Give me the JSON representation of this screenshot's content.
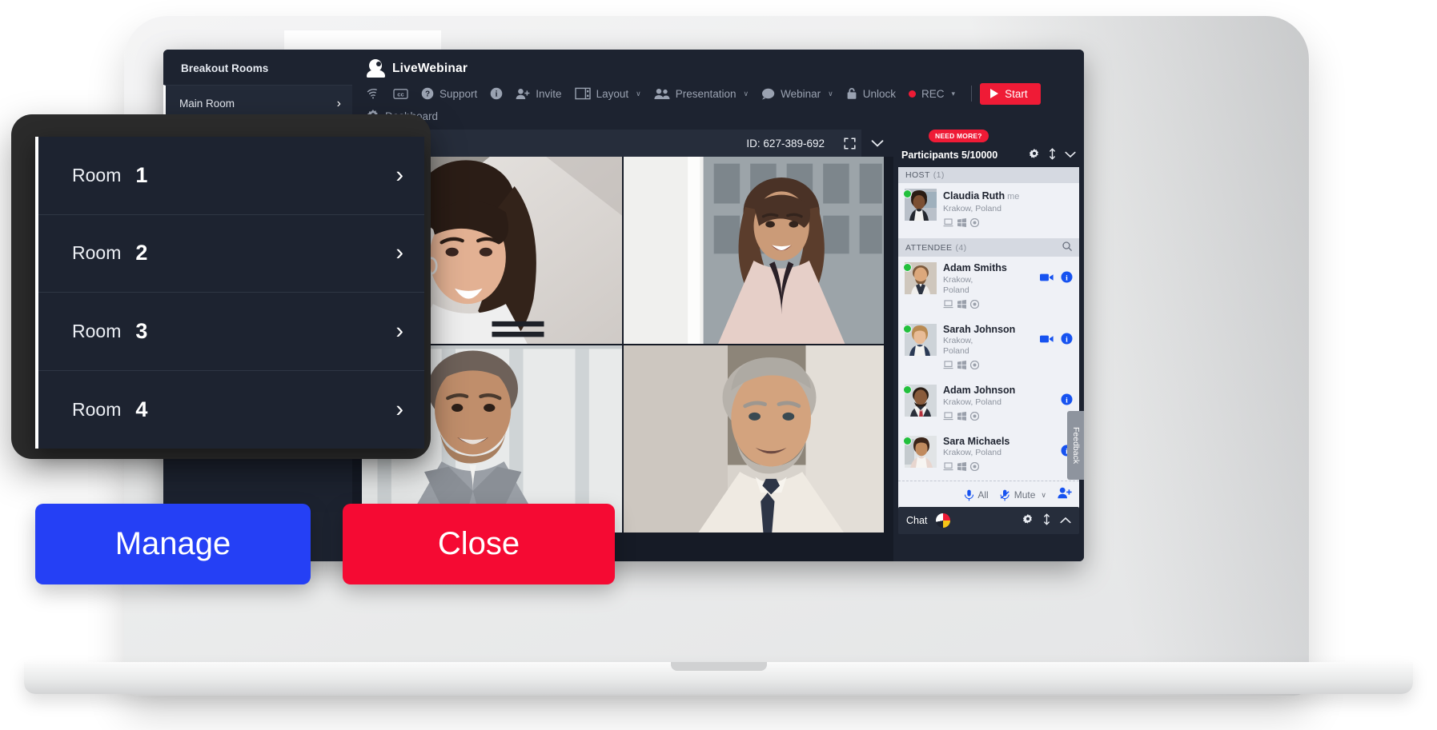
{
  "app": {
    "brand": "LiveWebinar",
    "brand_icon": "livewebinar-logo-icon"
  },
  "breakout": {
    "title": "Breakout Rooms",
    "items": [
      {
        "label": "Main Room",
        "chevron": "›"
      }
    ]
  },
  "toolbar": {
    "items": [
      {
        "name": "wifi",
        "icon": "wifi-icon",
        "label": ""
      },
      {
        "name": "captions",
        "icon": "closed-captions-icon",
        "label": ""
      },
      {
        "name": "support",
        "icon": "question-circle-icon",
        "label": "Support"
      },
      {
        "name": "info",
        "icon": "info-circle-icon",
        "label": ""
      },
      {
        "name": "invite",
        "icon": "user-add-icon",
        "label": "Invite"
      },
      {
        "name": "layout",
        "icon": "layout-icon",
        "label": "Layout",
        "caret": "∨"
      },
      {
        "name": "presentation",
        "icon": "people-icon",
        "label": "Presentation",
        "caret": "∨"
      },
      {
        "name": "webinar",
        "icon": "chat-bubble-icon",
        "label": "Webinar",
        "caret": "∨"
      },
      {
        "name": "unlock",
        "icon": "lock-icon",
        "label": "Unlock"
      },
      {
        "name": "rec",
        "icon": "record-dot-icon",
        "label": "REC",
        "caret": "▾"
      }
    ],
    "start_label": "Start",
    "dashboard_label": "Dashboard",
    "language_flag": "us-flag-icon",
    "language_caret": "▾"
  },
  "stage": {
    "id_label": "ID: 627-389-692",
    "fullscreen_icon": "expand-icon",
    "collapse_icon": "chevron-down-icon",
    "tiles": [
      {
        "name": "video-tile-1",
        "person": "woman-ponytail"
      },
      {
        "name": "video-tile-2",
        "person": "woman-window"
      },
      {
        "name": "video-tile-3",
        "person": "man-bald-suit"
      },
      {
        "name": "video-tile-4",
        "person": "man-grey-tie"
      }
    ]
  },
  "participants": {
    "need_more_badge": "NEED MORE?",
    "title": "Participants 5/10000",
    "settings_icon": "gear-icon",
    "resize_icon": "resize-vertical-icon",
    "collapse_icon": "chevron-down-icon",
    "groups": [
      {
        "label": "HOST",
        "count": "(1)",
        "search_icon": "search-icon",
        "people": [
          {
            "name": "Claudia Ruth",
            "me": "me",
            "location": "Krakow, Poland",
            "devices": [
              "laptop-icon",
              "windows-icon",
              "chrome-icon"
            ],
            "status": "online",
            "actions": []
          }
        ]
      },
      {
        "label": "ATTENDEE",
        "count": "(4)",
        "search_icon": "search-icon",
        "people": [
          {
            "name": "Adam Smiths",
            "me": "",
            "location": "Krakow,\nPoland",
            "devices": [
              "laptop-icon",
              "windows-icon",
              "chrome-icon"
            ],
            "status": "online",
            "actions": [
              "camera-icon",
              "info-icon"
            ]
          },
          {
            "name": "Sarah Johnson",
            "me": "",
            "location": "Krakow,\nPoland",
            "devices": [
              "laptop-icon",
              "windows-icon",
              "chrome-icon"
            ],
            "status": "online",
            "actions": [
              "camera-icon",
              "info-icon"
            ]
          },
          {
            "name": "Adam Johnson",
            "me": "",
            "location": "Krakow, Poland",
            "devices": [
              "laptop-icon",
              "windows-icon",
              "chrome-icon"
            ],
            "status": "online",
            "actions": [
              "info-icon"
            ]
          },
          {
            "name": "Sara Michaels",
            "me": "",
            "location": "Krakow, Poland",
            "devices": [
              "laptop-icon",
              "windows-icon",
              "chrome-icon"
            ],
            "status": "online",
            "actions": [
              "info-icon"
            ]
          }
        ]
      }
    ],
    "footer": {
      "all_label": "All",
      "all_icon": "microphone-icon",
      "mute_label": "Mute",
      "mute_icon": "microphone-muted-icon",
      "mute_caret": "∨",
      "add_user_icon": "add-user-icon"
    }
  },
  "feedback_tab": "Feedback",
  "chat": {
    "label": "Chat",
    "translate_icon": "translate-globe-icon",
    "settings_icon": "gear-icon",
    "resize_icon": "resize-vertical-icon",
    "collapse_icon": "chevron-up-icon"
  },
  "rooms_overlay": {
    "rooms": [
      {
        "word": "Room",
        "num": "1",
        "chevron": "›"
      },
      {
        "word": "Room",
        "num": "2",
        "chevron": "›"
      },
      {
        "word": "Room",
        "num": "3",
        "chevron": "›"
      },
      {
        "word": "Room",
        "num": "4",
        "chevron": "›"
      }
    ]
  },
  "cta": {
    "manage_label": "Manage",
    "close_label": "Close",
    "manage_color": "#2540f5",
    "close_color": "#f50a33"
  },
  "colors": {
    "app_bg": "#1d2330",
    "panel_bg": "#eff1f6",
    "accent_red": "#ef1b36",
    "accent_blue": "#1652f0",
    "online_green": "#22c03c"
  }
}
